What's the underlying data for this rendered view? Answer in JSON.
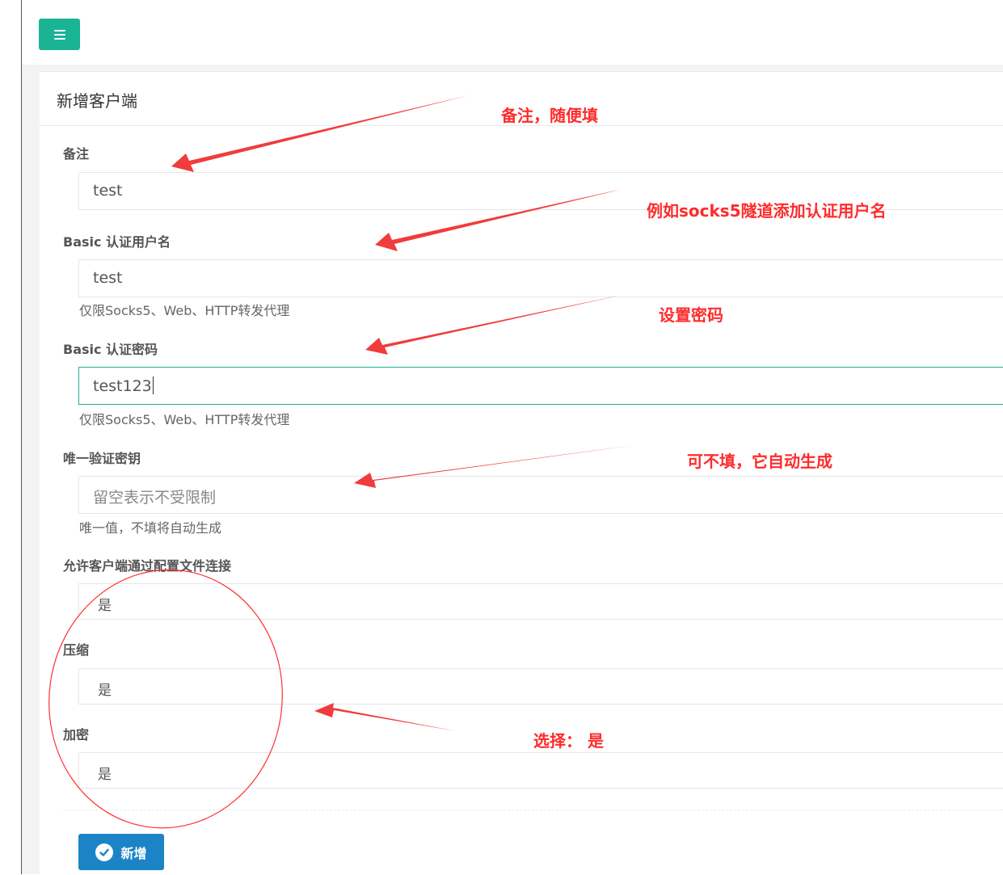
{
  "panel": {
    "title": "新增客户端"
  },
  "form": {
    "remark": {
      "label": "备注",
      "value": "test"
    },
    "basic_user": {
      "label": "Basic 认证用户名",
      "value": "test",
      "help": "仅限Socks5、Web、HTTP转发代理"
    },
    "basic_pass": {
      "label": "Basic 认证密码",
      "value": "test123",
      "help": "仅限Socks5、Web、HTTP转发代理"
    },
    "vkey": {
      "label": "唯一验证密钥",
      "placeholder": "留空表示不受限制",
      "help": "唯一值，不填将自动生成"
    },
    "config_conn": {
      "label": "允许客户端通过配置文件连接",
      "value": "是"
    },
    "compress": {
      "label": "压缩",
      "value": "是"
    },
    "crypt": {
      "label": "加密",
      "value": "是"
    },
    "submit_label": "新增"
  },
  "annotations": {
    "remark_note": "备注，随便填",
    "user_note": "例如socks5隧道添加认证用户名",
    "pass_note": "设置密码",
    "vkey_note": "可不填，它自动生成",
    "select_note": "选择： 是",
    "color": "#ff2b2b"
  },
  "colors": {
    "primary": "#1ab394",
    "submit": "#1c84c6",
    "page_bg": "#f3f3f4"
  },
  "icons": {
    "menu": "bars-icon",
    "submit": "check-circle-icon"
  }
}
